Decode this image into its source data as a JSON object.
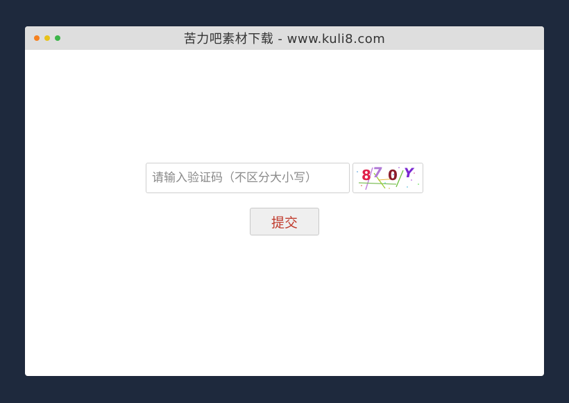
{
  "window": {
    "title": "苦力吧素材下载 - www.kuli8.com",
    "controls": [
      {
        "name": "close",
        "color": "#f5811f"
      },
      {
        "name": "minimize",
        "color": "#e8c21b"
      },
      {
        "name": "maximize",
        "color": "#3cb54a"
      }
    ]
  },
  "form": {
    "captcha_input": {
      "value": "",
      "placeholder": "请输入验证码（不区分大小写）"
    },
    "captcha_image": {
      "characters": [
        {
          "char": "8",
          "color": "#e0204a"
        },
        {
          "char": "7",
          "color": "#b07ad6"
        },
        {
          "char": "0",
          "color": "#8b1c2b"
        },
        {
          "char": "Y",
          "color": "#7a28d0"
        }
      ]
    },
    "submit_label": "提交"
  }
}
